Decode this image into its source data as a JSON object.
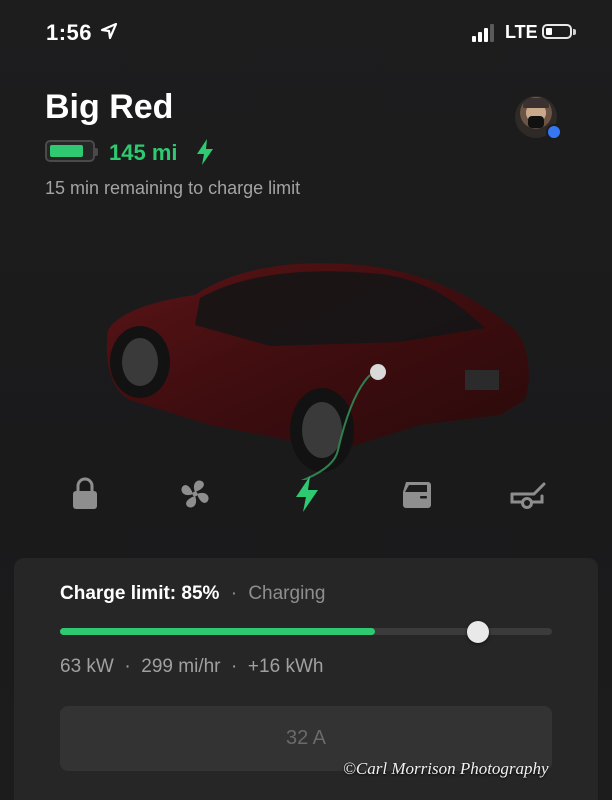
{
  "status_bar": {
    "time": "1:56",
    "network": "LTE",
    "location_icon": "location-arrow-icon",
    "signal_bars": 3,
    "battery_icon": "battery-low-icon"
  },
  "vehicle": {
    "name": "Big Red",
    "range": "145 mi",
    "battery_level": 0.82,
    "charging_icon": "lightning-bolt-icon",
    "remaining_text": "15 min remaining to charge limit"
  },
  "controls": [
    {
      "name": "lock",
      "icon": "lock-icon"
    },
    {
      "name": "climate",
      "icon": "fan-icon"
    },
    {
      "name": "charging",
      "icon": "lightning-bolt-icon"
    },
    {
      "name": "frunk",
      "icon": "car-door-icon"
    },
    {
      "name": "trunk",
      "icon": "open-trunk-icon"
    }
  ],
  "charge_panel": {
    "limit_text": "Charge limit: 85%",
    "separator": "·",
    "state": "Charging",
    "current_level_percent": 64,
    "limit_percent": 85,
    "stats": "63 kW  ·  299 mi/hr  ·  +16 kWh",
    "amps_label": "32 A"
  },
  "watermark": "©Carl Morrison Photography",
  "colors": {
    "accent_green": "#2ec971",
    "background": "#1b1b1c",
    "panel": "#262627",
    "avatar_badge": "#3478f6"
  }
}
